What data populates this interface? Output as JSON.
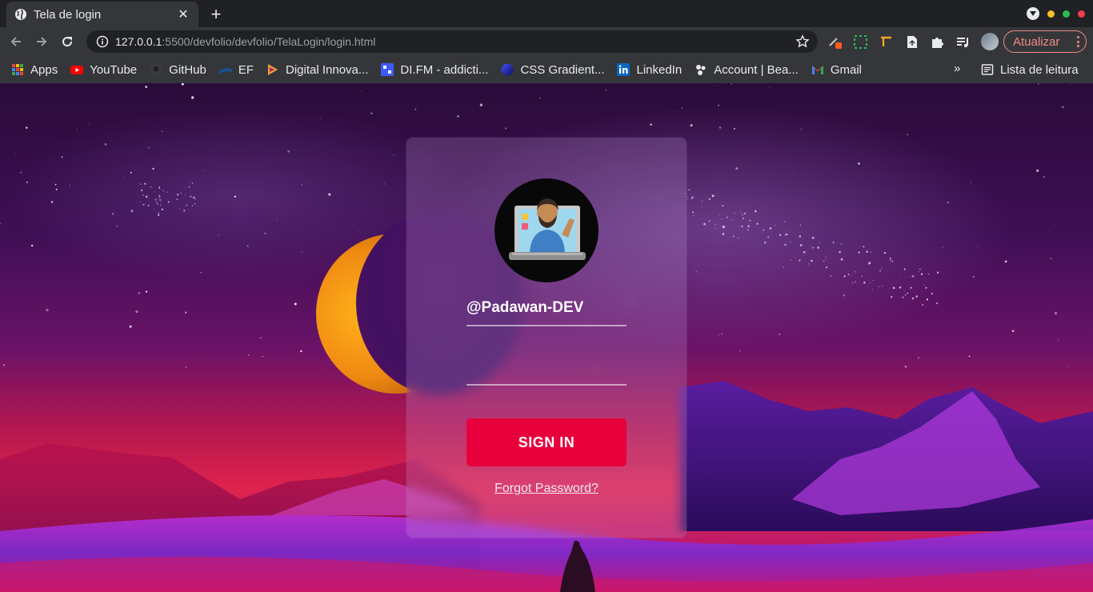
{
  "browser": {
    "tab": {
      "title": "Tela de login",
      "favicon": "globe-icon",
      "close_glyph": "✕"
    },
    "new_tab_glyph": "+",
    "window_dots": [
      "#f6c026",
      "#2dbd4e",
      "#f23d4f"
    ],
    "address": {
      "host": "127.0.0.1",
      "path": ":5500/devfolio/devfolio/TelaLogin/login.html"
    },
    "update_label": "Atualizar",
    "accent": "#f28b82",
    "bookmarks": [
      {
        "label": "Apps",
        "icon": "apps-grid-icon"
      },
      {
        "label": "YouTube",
        "icon": "youtube-icon"
      },
      {
        "label": "GitHub",
        "icon": "github-icon"
      },
      {
        "label": "EF",
        "icon": "ef-icon"
      },
      {
        "label": "Digital Innova...",
        "icon": "digital-innovation-icon"
      },
      {
        "label": "DI.FM - addicti...",
        "icon": "difm-icon"
      },
      {
        "label": "CSS Gradient...",
        "icon": "css-gradient-icon"
      },
      {
        "label": "LinkedIn",
        "icon": "linkedin-icon"
      },
      {
        "label": "Account | Bea...",
        "icon": "account-icon"
      },
      {
        "label": "Gmail",
        "icon": "gmail-icon"
      }
    ],
    "bookmarks_more": "»",
    "reading_list": "Lista de leitura"
  },
  "login": {
    "username": "@Padawan-DEV",
    "password": "",
    "signin_label": "SIGN IN",
    "forgot_label": "Forgot Password?",
    "button_color": "#e8003d"
  }
}
